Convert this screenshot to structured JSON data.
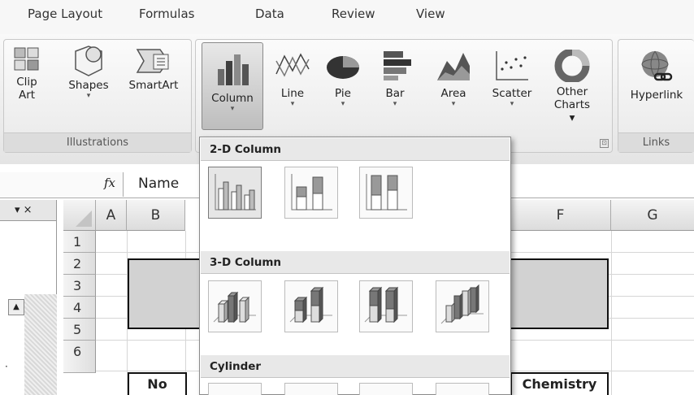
{
  "tabs": [
    "Page Layout",
    "Formulas",
    "Data",
    "Review",
    "View"
  ],
  "ribbon": {
    "illustrations": {
      "title": "Illustrations",
      "buttons": [
        {
          "label": "Clip Art",
          "icon": "clip-art-icon"
        },
        {
          "label": "Shapes",
          "icon": "shapes-icon",
          "dropdown": "▾"
        },
        {
          "label": "SmartArt",
          "icon": "smartart-icon"
        }
      ]
    },
    "charts": {
      "launcher": "⊡",
      "buttons": [
        {
          "label": "Column",
          "icon": "column-chart-icon",
          "dropdown": "▾"
        },
        {
          "label": "Line",
          "icon": "line-chart-icon",
          "dropdown": "▾"
        },
        {
          "label": "Pie",
          "icon": "pie-chart-icon",
          "dropdown": "▾"
        },
        {
          "label": "Bar",
          "icon": "bar-chart-icon",
          "dropdown": "▾"
        },
        {
          "label": "Area",
          "icon": "area-chart-icon",
          "dropdown": "▾"
        },
        {
          "label": "Scatter",
          "icon": "scatter-chart-icon",
          "dropdown": "▾"
        },
        {
          "label": "Other Charts",
          "icon": "other-charts-icon",
          "dropdown": "▾"
        }
      ]
    },
    "links": {
      "title": "Links",
      "buttons": [
        {
          "label": "Hyperlink",
          "icon": "hyperlink-icon"
        }
      ]
    }
  },
  "formula_bar": {
    "fx": "fx",
    "value": "Name"
  },
  "pane_header": "▾ ×",
  "columns": [
    "A",
    "B",
    "F",
    "G"
  ],
  "rows": [
    "1",
    "2",
    "3",
    "4",
    "5",
    "6"
  ],
  "cells": {
    "b6": "No",
    "f6": "Chemistry"
  },
  "gallery": {
    "sections": [
      "2-D Column",
      "3-D Column",
      "Cylinder"
    ],
    "items_2d": [
      "Clustered Column",
      "Stacked Column",
      "100% Stacked Column"
    ],
    "items_3d": [
      "3-D Clustered Column",
      "3-D Stacked Column",
      "3-D 100% Stacked Column",
      "3-D Column"
    ]
  },
  "scroll_up": "▲",
  "sidebar_mark": "·"
}
